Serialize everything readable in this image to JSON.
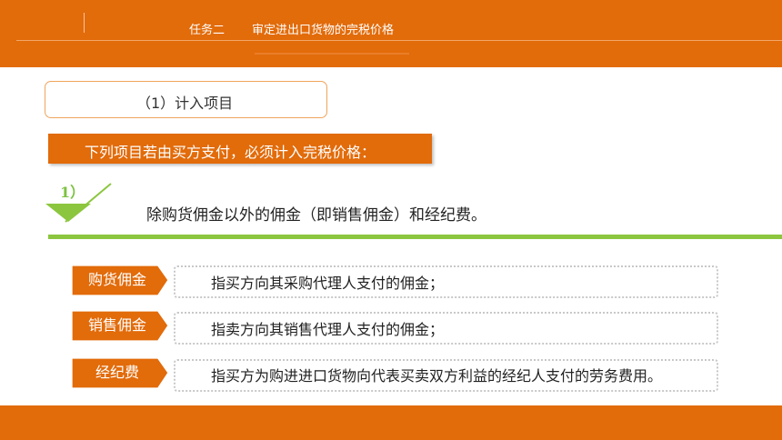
{
  "header": {
    "task_label": "任务二",
    "title": "审定进出口货物的完税价格"
  },
  "section": {
    "label": "（1）计入项目"
  },
  "banner": {
    "text": "下列项目若由买方支付，必须计入完税价格："
  },
  "point": {
    "marker": "1）",
    "text": "除购货佣金以外的佣金（即销售佣金）和经纪费。"
  },
  "items": [
    {
      "tag": "购货佣金",
      "desc": "指买方向其采购代理人支付的佣金；"
    },
    {
      "tag": "销售佣金",
      "desc": "指卖方向其销售代理人支付的佣金；"
    },
    {
      "tag": "经纪费",
      "desc": "指买方为购进进口货物向代表买卖双方利益的经纪人支付的劳务费用。"
    }
  ],
  "colors": {
    "orange": "#e26b0a",
    "green": "#8cc63f"
  }
}
